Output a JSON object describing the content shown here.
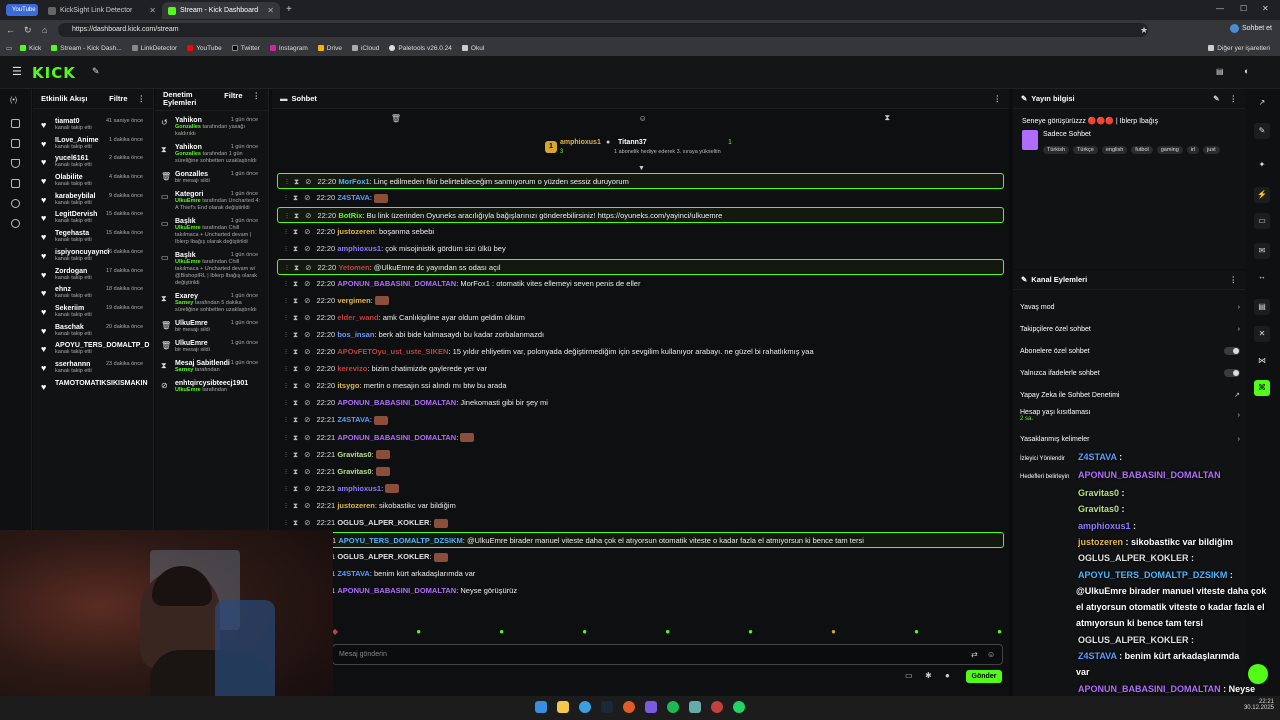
{
  "browser": {
    "tabs": [
      {
        "label": "YouTube",
        "active": false
      },
      {
        "label": "KickSight Link Detector",
        "active": false
      },
      {
        "label": "Stream - Kick Dashboard",
        "active": true
      }
    ],
    "url": "https://dashboard.kick.com/stream",
    "bookmarks": [
      "Kick",
      "Stream - Kick Dash...",
      "LinkDetector",
      "YouTube",
      "Twitter",
      "Instagram",
      "Drive",
      "iCloud",
      "Paletools v26.0.24",
      "Okul"
    ],
    "right_bookmark": "Diğer yer işaretleri",
    "profile_label": "Sohbet et"
  },
  "header": {
    "logo": "KICK"
  },
  "activity": {
    "title": "Etkinlik Akışı",
    "filter": "Filtre",
    "items": [
      {
        "name": "tiamat0",
        "sub": "kanalı takip etti",
        "time": "41 saniye önce"
      },
      {
        "name": "ILove_Anime",
        "sub": "kanalı takip etti",
        "time": "1 dakika önce"
      },
      {
        "name": "yucel6161",
        "sub": "kanalı takip etti",
        "time": "2 dakika önce"
      },
      {
        "name": "Olabilite",
        "sub": "kanalı takip etti",
        "time": "4 dakika önce"
      },
      {
        "name": "karabeybilal",
        "sub": "kanalı takip etti",
        "time": "9 dakika önce"
      },
      {
        "name": "LegitDervish",
        "sub": "kanalı takip etti",
        "time": "15 dakika önce"
      },
      {
        "name": "Tegehasta",
        "sub": "kanalı takip etti",
        "time": "15 dakika önce"
      },
      {
        "name": "ispiyoncuyaynci",
        "sub": "kanalı takip etti",
        "time": "16 dakika önce"
      },
      {
        "name": "Zordogan",
        "sub": "kanalı takip etti",
        "time": "17 dakika önce"
      },
      {
        "name": "ehnz",
        "sub": "kanalı takip etti",
        "time": "18 dakika önce"
      },
      {
        "name": "Sekeriim",
        "sub": "kanalı takip etti",
        "time": "19 dakika önce"
      },
      {
        "name": "Baschak",
        "sub": "kanalı takip etti",
        "time": "20 dakika önce"
      },
      {
        "name": "APOYU_TERS_DOMALTP_D",
        "sub": "kanalı takip etti",
        "time": ""
      },
      {
        "name": "sserhannn",
        "sub": "kanalı takip etti",
        "time": "23 dakika önce"
      },
      {
        "name": "TAMOTOMATIKSIKISMAKIN",
        "sub": "",
        "time": ""
      }
    ]
  },
  "moderation": {
    "title": "Denetim Eylemleri",
    "filter": "Filtre",
    "items": [
      {
        "name": "Yahikon",
        "time": "1 gün önce",
        "actor": "Gonzalles",
        "desc": "tarafından yasağı kaldırıldı"
      },
      {
        "name": "Yahikon",
        "time": "1 gün önce",
        "actor": "Gonzalles",
        "desc": "tarafından 1 gün süreliğine sohbetten uzaklaştırıldı"
      },
      {
        "name": "Gonzalles",
        "time": "1 gün önce",
        "actor": "",
        "desc": "bir mesajı sildi"
      },
      {
        "name": "Kategori",
        "time": "1 gün önce",
        "actor": "UlkuEmre",
        "desc": "tarafından Uncharted 4: A Thief's End olarak değiştirildi"
      },
      {
        "name": "Başlık",
        "time": "1 gün önce",
        "actor": "UlkuEmre",
        "desc": "tarafından Chill takılmaca + Uncharted devam | Iblerp Ibağış olarak değiştirildi"
      },
      {
        "name": "Başlık",
        "time": "1 gün önce",
        "actor": "UlkuEmre",
        "desc": "tarafından Chill takılmaca + Uncharted devam w/ @BishopIRL | Iblerp Ibağış olarak değiştirildi"
      },
      {
        "name": "Exarey",
        "time": "1 gün önce",
        "actor": "Sarney",
        "desc": "tarafından 5 dakika süreliğine sohbetten uzaklaştırıldı"
      },
      {
        "name": "UlkuEmre",
        "time": "1 gün önce",
        "actor": "",
        "desc": "bir mesajı sildi"
      },
      {
        "name": "UlkuEmre",
        "time": "1 gün önce",
        "actor": "",
        "desc": "bir mesajı sildi"
      },
      {
        "name": "Mesaj Sabitlendi",
        "time": "1 gün önce",
        "actor": "Sarney",
        "desc": "tarafından"
      },
      {
        "name": "enhtqircysibteecj1901",
        "time": "",
        "actor": "UlkuEmre",
        "desc": "tarafından"
      }
    ]
  },
  "chat": {
    "title": "Sohbet",
    "leaderboard": {
      "first_name": "amphioxus1",
      "first_count": "3",
      "second_name": "Titann37",
      "second_sub": "1 abonelik hediye ederek 3. sıraya yükseltin",
      "second_count": "1"
    },
    "messages": [
      {
        "time": "22:20",
        "user": "MorFox1",
        "color": "#4ab4ff",
        "text": ": Linç edilmeden fikir belirtebileceğim sanmıyorum o yüzden sessiz duruyorum",
        "hl": true
      },
      {
        "time": "22:20",
        "user": "Z4STAVA",
        "color": "#5a9cff",
        "text": ":",
        "hl": false,
        "emote": true
      },
      {
        "time": "22:20",
        "user": "BotRix",
        "color": "#53fc18",
        "text": ": Bu link üzerinden Oyuneks aracılığıyla bağışlarınızı gönderebilirsiniz! https://oyuneks.com/yayinci/ulkuemre",
        "hl": true
      },
      {
        "time": "22:20",
        "user": "justozeren",
        "color": "#e0b84a",
        "text": ": boşanma sebebi",
        "hl": false
      },
      {
        "time": "22:20",
        "user": "amphioxus1",
        "color": "#8a7cff",
        "text": ": çok misojinistik gördüm sizi ülkü bey",
        "hl": false
      },
      {
        "time": "22:20",
        "user": "Yetomen",
        "color": "#c04040",
        "text": ": @UlkuEmre dc yayından ss odası açıl",
        "hl": true
      },
      {
        "time": "22:20",
        "user": "APONUN_BABASINI_DOMALTAN",
        "color": "#b06cff",
        "text": ": MorFox1 : otomatik vites ellemeyi seven penis de eller",
        "hl": false
      },
      {
        "time": "22:20",
        "user": "vergimen",
        "color": "#e0b84a",
        "text": ":",
        "hl": false,
        "emote": true
      },
      {
        "time": "22:20",
        "user": "elder_wand",
        "color": "#c04040",
        "text": ": amk Canlıkigiline ayar oldum geldim ülküm",
        "hl": false
      },
      {
        "time": "22:20",
        "user": "bos_insan",
        "color": "#6a9cff",
        "text": ": berk abi bide kalmasaydı bu kadar zorbalanmazdı",
        "hl": false
      },
      {
        "time": "22:20",
        "user": "APOvFETOyu_ust_uste_SIKEN",
        "color": "#c04040",
        "text": ": 15 yıldır ehliyetim var, polonyada değiştirmediğim için sevgilim kullanıyor arabayı. ne güzel bi rahatlıkmış yaa",
        "hl": false
      },
      {
        "time": "22:20",
        "user": "kerevizo",
        "color": "#c04040",
        "text": ": bizim chatimizde gaylerede yer var",
        "hl": false
      },
      {
        "time": "22:20",
        "user": "itsygo",
        "color": "#e0b84a",
        "text": ": mertin o mesajın ssi alındı mı btw bu arada",
        "hl": false
      },
      {
        "time": "22:20",
        "user": "APONUN_BABASINI_DOMALTAN",
        "color": "#b06cff",
        "text": ": Jinekomasti gibi bir şey mi",
        "hl": false
      },
      {
        "time": "22:21",
        "user": "Z4STAVA",
        "color": "#5a9cff",
        "text": ":",
        "hl": false,
        "emote": true
      },
      {
        "time": "22:21",
        "user": "APONUN_BABASINI_DOMALTAN",
        "color": "#b06cff",
        "text": ":",
        "hl": false,
        "emote": true
      },
      {
        "time": "22:21",
        "user": "Gravitas0",
        "color": "#b5e08a",
        "text": ":",
        "hl": false,
        "emote": true
      },
      {
        "time": "22:21",
        "user": "Gravitas0",
        "color": "#b5e08a",
        "text": ":",
        "hl": false,
        "emote": true
      },
      {
        "time": "22:21",
        "user": "amphioxus1",
        "color": "#8a7cff",
        "text": ":",
        "hl": false,
        "emote": true
      },
      {
        "time": "22:21",
        "user": "justozeren",
        "color": "#e0b84a",
        "text": ": sikobastikc var bildiğim",
        "hl": false
      },
      {
        "time": "22:21",
        "user": "OGLUS_ALPER_KOKLER",
        "color": "#e0e0e0",
        "text": ":",
        "hl": false,
        "emote": true
      },
      {
        "time": "22:21",
        "user": "APOYU_TERS_DOMALTP_DZSIKM",
        "color": "#4ab4ff",
        "text": ": @UlkuEmre birader manuel viteste daha çok el atıyorsun otomatik viteste o kadar fazla el atmıyorsun ki bence tam tersi",
        "hl": true
      },
      {
        "time": "22:21",
        "user": "OGLUS_ALPER_KOKLER",
        "color": "#e0e0e0",
        "text": ":",
        "hl": false,
        "emote": true
      },
      {
        "time": "22:21",
        "user": "Z4STAVA",
        "color": "#5a9cff",
        "text": ": benim kürt arkadaşlarımda var",
        "hl": false
      },
      {
        "time": "22:21",
        "user": "APONUN_BABASINI_DOMALTAN",
        "color": "#b06cff",
        "text": ": Neyse görüşürüz",
        "hl": false
      }
    ],
    "input_placeholder": "Mesaj gönderin",
    "send_label": "Gönder"
  },
  "stream_info": {
    "title": "Yayın bilgisi",
    "stream_title": "Seneye görüşürüzzz 🔴🔴🔴 | Iblerp Ibağış",
    "category": "Sadece Sohbet",
    "tags": [
      "Türkish",
      "Türkçe",
      "english",
      "futbol",
      "gaming",
      "irl",
      "just"
    ]
  },
  "channel_actions": {
    "title": "Kanal Eylemleri",
    "rows": [
      {
        "label": "Yavaş mod",
        "kind": "chev"
      },
      {
        "label": "Takipçilere özel sohbet",
        "kind": "chev"
      },
      {
        "label": "Abonelere özel sohbet",
        "kind": "toggle"
      },
      {
        "label": "Yalnızca ifadelerle sohbet",
        "kind": "toggle"
      },
      {
        "label": "Yapay Zeka ile Sohbet Denetimi",
        "kind": "ext"
      },
      {
        "label": "Hesap yaşı kısıtlaması",
        "kind": "chev",
        "sub": "2 sa."
      },
      {
        "label": "Yasaklanmış kelimeler",
        "kind": "chev"
      },
      {
        "label": "İzleyici Yönlendir",
        "kind": "none"
      },
      {
        "label": "Hedefleri belirleyin",
        "kind": "none"
      }
    ]
  },
  "overlay_chat": [
    {
      "user": "Z4STAVA",
      "color": "#5a9cff",
      "text": " :"
    },
    {
      "user": "APONUN_BABASINI_DOMALTAN",
      "color": "#b06cff",
      "text": ""
    },
    {
      "user": "Gravitas0",
      "color": "#b5e08a",
      "text": " :"
    },
    {
      "user": "Gravitas0",
      "color": "#b5e08a",
      "text": " :"
    },
    {
      "user": "amphioxus1",
      "color": "#8a7cff",
      "text": " :"
    },
    {
      "user": "justozeren",
      "color": "#e0b84a",
      "text": " : sikobastikc var bildiğim"
    },
    {
      "user": "OGLUS_ALPER_KOKLER",
      "color": "#e0e0e0",
      "text": " :"
    },
    {
      "user": "APOYU_TERS_DOMALTP_DZSIKM",
      "color": "#4ab4ff",
      "text": " :"
    },
    {
      "user": "",
      "color": "#fff",
      "text": "@UlkuEmre birader manuel viteste daha çok"
    },
    {
      "user": "",
      "color": "#fff",
      "text": "el atıyorsun otomatik viteste o kadar fazla el"
    },
    {
      "user": "",
      "color": "#fff",
      "text": "atmıyorsun ki bence tam tersi"
    },
    {
      "user": "OGLUS_ALPER_KOKLER",
      "color": "#e0e0e0",
      "text": " :"
    },
    {
      "user": "Z4STAVA",
      "color": "#5a9cff",
      "text": " : benim kürt arkadaşlarımda"
    },
    {
      "user": "",
      "color": "#fff",
      "text": "var"
    },
    {
      "user": "APONUN_BABASINI_DOMALTAN",
      "color": "#b06cff",
      "text": " : Neyse"
    },
    {
      "user": "",
      "color": "#fff",
      "text": "görüşürüz"
    }
  ],
  "taskbar": {
    "time": "22:21",
    "date": "30.12.2025"
  }
}
